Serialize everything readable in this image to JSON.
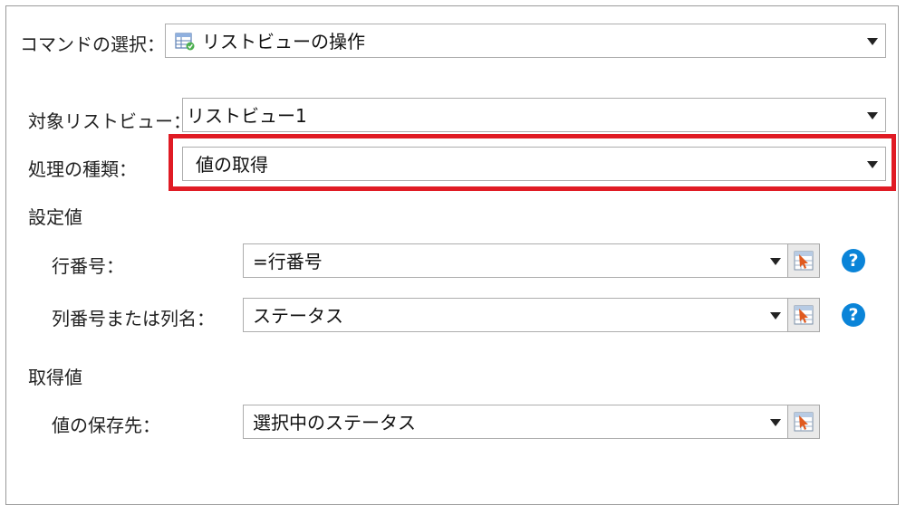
{
  "command": {
    "label": "コマンドの選択：",
    "value": "リストビューの操作",
    "icon": "table-icon"
  },
  "target_listview": {
    "label": "対象リストビュー：",
    "value": "リストビュー1"
  },
  "operation_type": {
    "label": "処理の種類：",
    "value": "値の取得"
  },
  "settings": {
    "heading": "設定値",
    "row_number": {
      "label": "行番号：",
      "value": "=行番号"
    },
    "column": {
      "label": "列番号または列名：",
      "value": "ステータス"
    }
  },
  "result": {
    "heading": "取得値",
    "store_to": {
      "label": "値の保存先：",
      "value": "選択中のステータス"
    }
  },
  "help_glyph": "?",
  "colors": {
    "highlight": "#e01b24",
    "help": "#0a84d8"
  }
}
